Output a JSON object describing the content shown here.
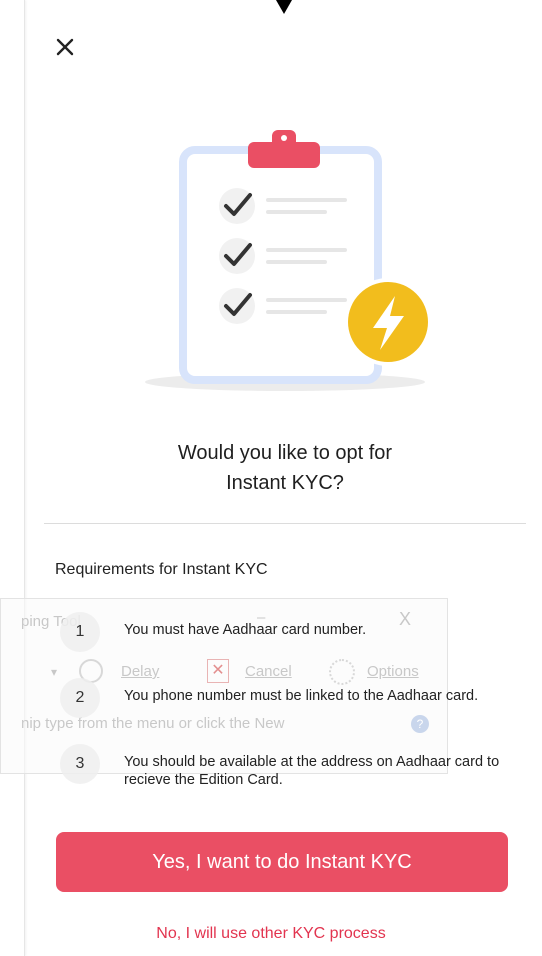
{
  "dialog": {
    "close_icon": "close-icon",
    "question_line1": "Would you like to opt for",
    "question_line2": "Instant KYC?",
    "requirements_title": "Requirements for Instant KYC",
    "requirements": [
      {
        "number": "1",
        "text": "You must have Aadhaar card number."
      },
      {
        "number": "2",
        "text": "You phone number must be linked to the Aadhaar card."
      },
      {
        "number": "3",
        "text": "You should be available at the address on Aadhaar card to recieve the Edition Card."
      }
    ],
    "primary_button": "Yes, I want to do Instant KYC",
    "secondary_link": "No, I will use other KYC process"
  },
  "illustration": {
    "name": "clipboard-checklist-lightning-illustration",
    "checklist_items": 3,
    "badge_icon": "lightning-bolt-icon"
  },
  "snipping_tool_ghost": {
    "title": "ping Tool",
    "minimize": "–",
    "close": "X",
    "caret": "▾",
    "delay": "Delay",
    "cancel": "Cancel",
    "options": "Options",
    "hint": "nip type from the menu or click the New",
    "help": "?"
  },
  "colors": {
    "accent": "#ea4f64",
    "link": "#e2344f",
    "badge": "#f2bd1d",
    "clip": "#ea4f64",
    "board_border": "#d8e4fb"
  }
}
